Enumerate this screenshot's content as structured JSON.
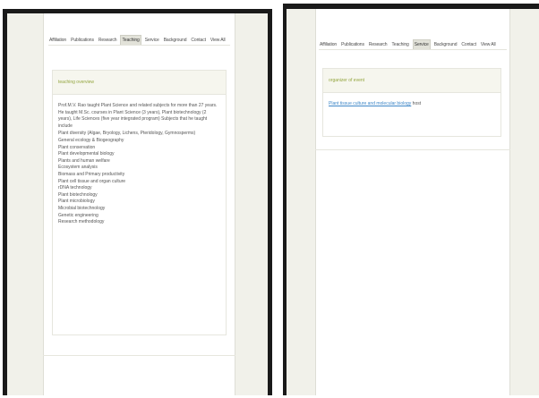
{
  "nav_tabs": [
    "Affiliation",
    "Publications",
    "Research",
    "Teaching",
    "Service",
    "Background",
    "Contact",
    "View All"
  ],
  "left_screen": {
    "active_tab": "Teaching",
    "panel_title": "teaching overview",
    "intro": "Prof.M.V. Rao taught Plant Science and related subjects for more than 27 years. He taught M.Sc. courses in Plant Science (3 years), Plant biotechnology (2 years), Life Sciences (five year integrated program) Subjects that he taught include",
    "subjects": [
      "Plant diversity (Algae, Bryology, Lichens, Pteridology, Gymnosperms)",
      "General ecology & Biogeography",
      "Plant conservation",
      "Plant developmental biology",
      "Plants and human welfare",
      "Ecosystem analysis",
      "Biomass and Primary productivity",
      "Plant cell tissue and organ culture",
      "rDNA technology",
      "Plant biotechnology",
      "Plant microbiology",
      "Microbial biotechnology",
      "Genetic engineering",
      "Research methodology"
    ]
  },
  "right_screen": {
    "active_tab": "Service",
    "panel_title": "organizer of event",
    "event_link": "Plant tissue culture and molecular biology",
    "event_tag": "host"
  }
}
